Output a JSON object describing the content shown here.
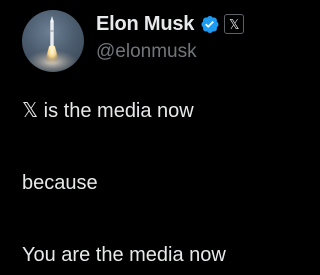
{
  "author": {
    "display_name": "Elon Musk",
    "handle": "@elonmusk",
    "verified": true,
    "verified_color": "#1d9bf0",
    "affiliate_badge": "𝕏",
    "avatar_icon": "rocket-launch-avatar"
  },
  "tweet": {
    "lines": [
      "𝕏 is the media now",
      "because",
      "You are the media now"
    ]
  },
  "colors": {
    "background": "#000000",
    "text_primary": "#e7e9ea",
    "text_secondary": "#71767b"
  }
}
